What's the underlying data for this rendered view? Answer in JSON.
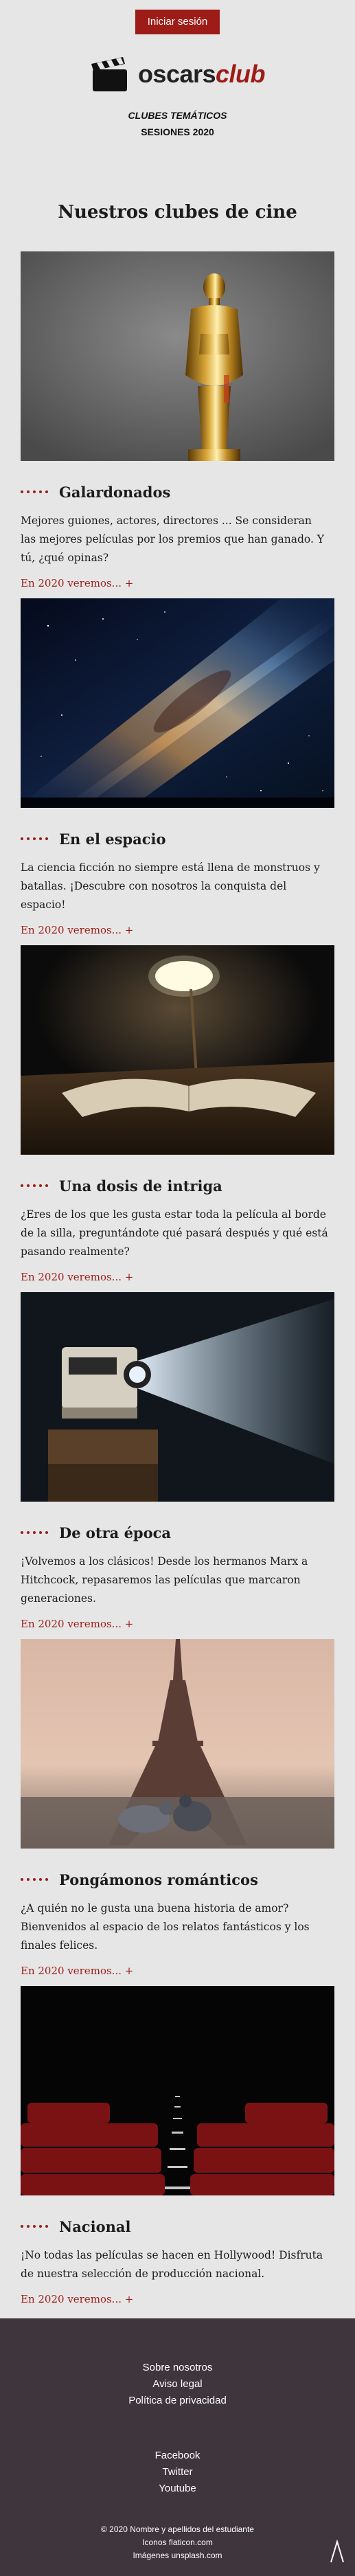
{
  "header": {
    "login_label": "Iniciar sesión",
    "logo_main": "oscars",
    "logo_accent": "club",
    "subtitle": "CLUBES TEMÁTICOS",
    "edition": "SESIONES 2020"
  },
  "main": {
    "title": "Nuestros clubes de cine",
    "clubs": [
      {
        "name": "Galardonados",
        "description": "Mejores guiones, actores, directores ... Se consideran las mejores películas por los premios que han ganado. Y tú, ¿qué opinas?",
        "more": "En 2020 veremos... +",
        "image": "oscar-statue"
      },
      {
        "name": "En el espacio",
        "description": "La ciencia ficción no siempre está llena de monstruos y batallas. ¡Descubre con nosotros la conquista del espacio!",
        "more": "En 2020 veremos... +",
        "image": "milky-way"
      },
      {
        "name": "Una dosis de intriga",
        "description": "¿Eres de los que les gusta estar toda la película al borde de la silla, preguntándote qué pasará después y qué está pasando realmente?",
        "more": "En 2020 veremos... +",
        "image": "desk-lamp-book"
      },
      {
        "name": "De otra época",
        "description": "¡Volvemos a los clásicos! Desde los hermanos Marx a Hitchcock, repasaremos las películas que marcaron generaciones.",
        "more": "En 2020 veremos... +",
        "image": "film-projector"
      },
      {
        "name": "Pongámonos románticos",
        "description": "¿A quién no le gusta una buena historia de amor? Bienvenidos al espacio de los relatos fantásticos y los finales felices.",
        "more": "En 2020 veremos... +",
        "image": "eiffel-pigeons"
      },
      {
        "name": "Nacional",
        "description": "¡No todas las películas se hacen en Hollywood! Disfruta de nuestra selección de producción nacional.",
        "more": "En 2020 veremos... +",
        "image": "cinema-seats"
      }
    ]
  },
  "footer": {
    "links": [
      "Sobre nosotros",
      "Aviso legal",
      "Política de privacidad"
    ],
    "social": [
      "Facebook",
      "Twitter",
      "Youtube"
    ],
    "legal": [
      "© 2020 Nombre y apellidos del estudiante",
      "Iconos flaticon.com",
      "Imágenes unsplash.com"
    ],
    "back_to_top_icon": "chevron-up-icon"
  },
  "colors": {
    "accent": "#9d1c17",
    "background": "#e6e6e6",
    "footer": "#3f353c"
  }
}
